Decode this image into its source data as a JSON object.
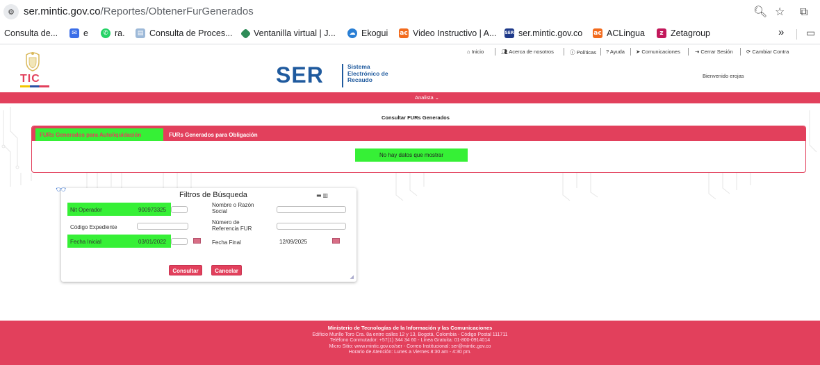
{
  "browser": {
    "url_host": "ser.mintic.gov.co",
    "url_path": "/Reportes/ObtenerFurGenerados",
    "icons": [
      "site-info-icon",
      "zoom-icon",
      "star-icon",
      "extensions-icon"
    ]
  },
  "bookmarks": [
    {
      "label": "Consulta de...",
      "icon_color": "#ffffff"
    },
    {
      "label": "e",
      "icon_color": "#3b6ee8"
    },
    {
      "label": "ra.",
      "icon_color": "#25d366"
    },
    {
      "label": "Consulta de Proces...",
      "icon_color": "#9db9d8"
    },
    {
      "label": "Ventanilla virtual | J...",
      "icon_color": "#2e8b57"
    },
    {
      "label": "Ekogui",
      "icon_color": "#2a7fd4"
    },
    {
      "label": "Video Instructivo | A...",
      "icon_color": "#f26b1d"
    },
    {
      "label": "ser.mintic.gov.co",
      "icon_color": "#1f3a8a"
    },
    {
      "label": "ACLingua",
      "icon_color": "#f26b1d"
    },
    {
      "label": "Zetagroup",
      "icon_color": "#c2185b"
    }
  ],
  "bookmarks_more": "»",
  "topnav": [
    "Inicio",
    "Acerca de nosotros",
    "Políticas",
    "Ayuda",
    "Comunicaciones",
    "Cerrar Sesión",
    "Cambiar Contra"
  ],
  "header": {
    "logo_text": "TIC",
    "ser": "SER",
    "ser_sub": "Sistema Electrónico de Recaudo",
    "welcome": "Bienvenido erojas"
  },
  "menu": {
    "role": "Analista ⌄"
  },
  "main": {
    "title": "Consultar FURs Generados",
    "tabs": [
      {
        "label": "FURs Generados para Autoliquidación",
        "active": true
      },
      {
        "label": "FURs Generados para Obligación",
        "active": false
      }
    ],
    "empty_message": "No hay datos que mostrar"
  },
  "filters": {
    "title": "Filtros de Búsqueda",
    "nit_label": "Nit Operador",
    "nit_value": "900973325",
    "razon_label": "Nombre o Razón Social",
    "razon_value": "",
    "expediente_label": "Código Expediente",
    "expediente_value": "",
    "referencia_label": "Número de Referencia FUR",
    "referencia_value": "",
    "fecha_inicial_label": "Fecha Inicial",
    "fecha_inicial_value": "03/01/2022",
    "fecha_final_label": "Fecha Final",
    "fecha_final_value": "12/09/2025",
    "consultar": "Consultar",
    "cancelar": "Cancelar"
  },
  "footer": {
    "line1": "Ministerio de Tecnologías de la Información y las Comunicaciones",
    "line2": "Edificio Murillo Toro Cra. 8a entre calles 12 y 13, Bogotá, Colombia - Código Postal 111711",
    "line3": "Teléfono Conmutador: +57(1) 344 34 60 - Línea Gratuita: 01-800-0914014",
    "line4": "Micro Sitio: www.mintic.gov.co/ser - Correo Institucional: ser@mintic.gov.co",
    "line5": "Horario de Atención: Lunes a Viernes 8:30 am - 4:30 pm."
  },
  "colors": {
    "brand_pink": "#e2405c",
    "highlight_green": "#36f036",
    "ser_blue": "#1f5a9e"
  }
}
